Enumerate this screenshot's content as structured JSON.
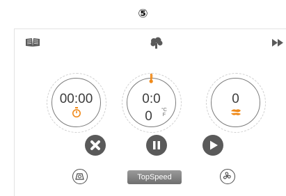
{
  "step": {
    "marker": "⑤"
  },
  "toolbar": {
    "recipe_icon": "open-book-icon",
    "center_icon": "thermomix-logo-icon",
    "next_icon": "fast-forward-icon"
  },
  "dials": {
    "time": {
      "value": "00:00",
      "icon": "stopwatch-icon",
      "icon_color": "#f08a1a"
    },
    "temperature": {
      "value": "0:0",
      "temperature": "0",
      "unit_c": "°C",
      "unit_f": "F",
      "icon": "thermometer-icon",
      "icon_color": "#f08a1a"
    },
    "speed": {
      "value": "0",
      "icon": "speed-blade-icon",
      "icon_color": "#f08a1a"
    }
  },
  "controls": {
    "stop_icon": "close-circle-icon",
    "pause_icon": "pause-circle-icon",
    "play_icon": "play-circle-icon"
  },
  "modes": {
    "scale_icon": "scale-icon",
    "turbo_label": "TopSpeed",
    "fan_icon": "fan-icon"
  },
  "colors": {
    "accent": "#f08a1a",
    "control": "#5a5a5a",
    "dial_border": "#7a7a7a"
  }
}
